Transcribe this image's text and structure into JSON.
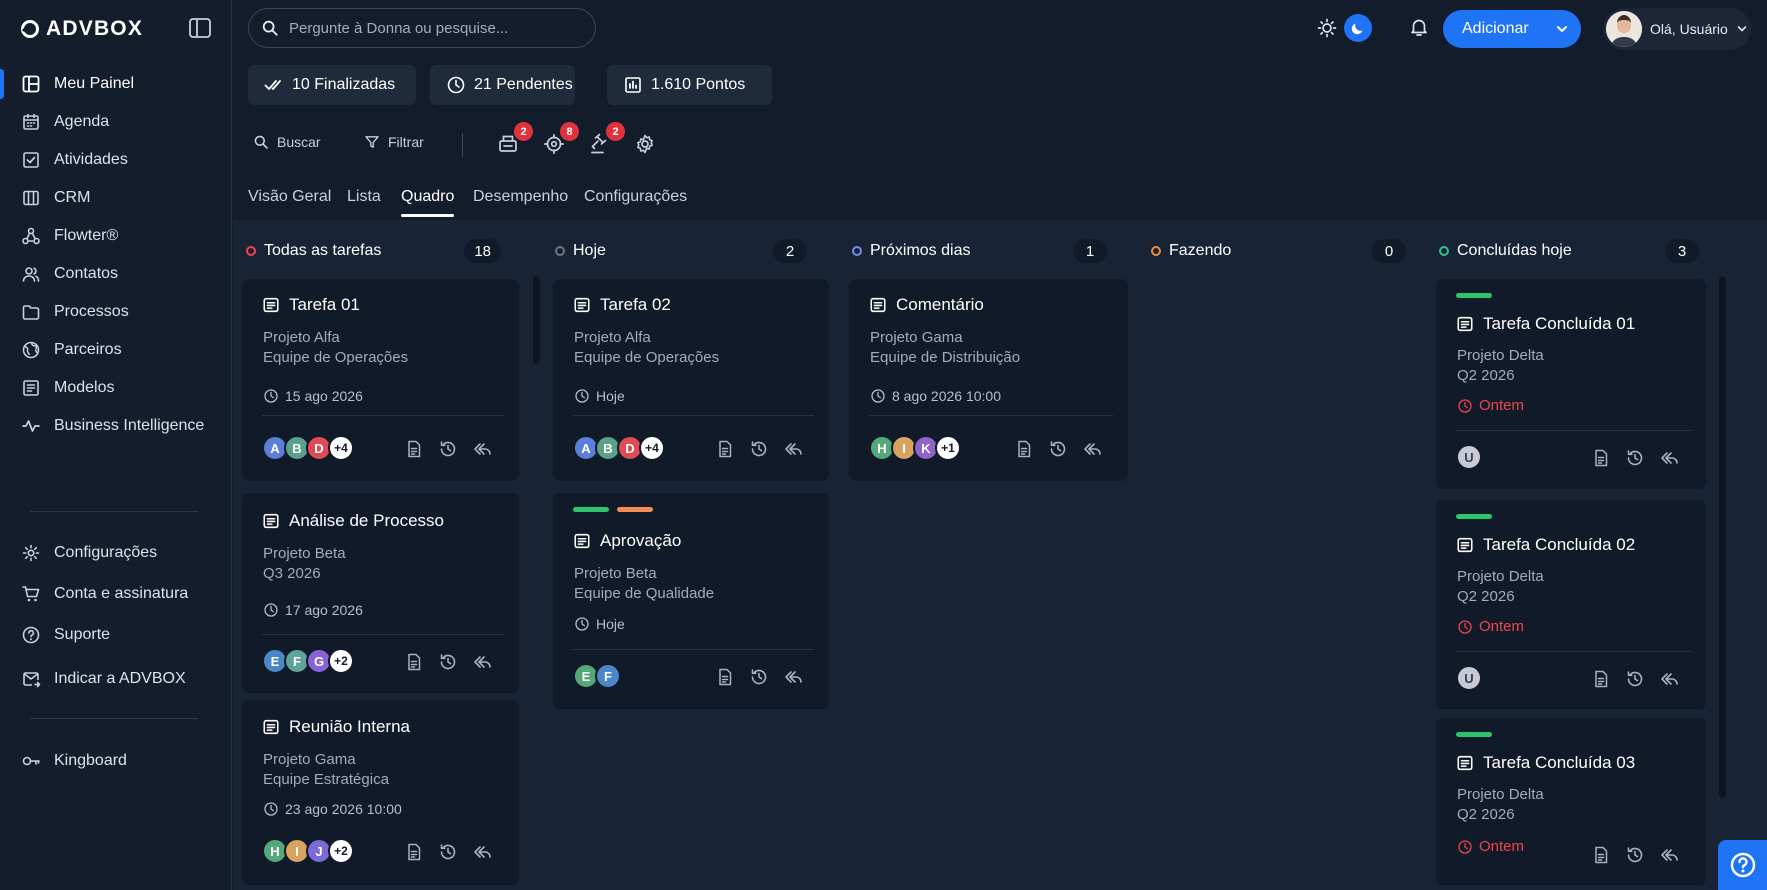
{
  "brand": {
    "name": "ADVBOX"
  },
  "sidebar": {
    "items": [
      {
        "label": "Meu Painel",
        "icon": "dashboard-icon"
      },
      {
        "label": "Agenda",
        "icon": "calendar-icon"
      },
      {
        "label": "Atividades",
        "icon": "checkbox-icon"
      },
      {
        "label": "CRM",
        "icon": "crm-icon"
      },
      {
        "label": "Flowter®",
        "icon": "flow-icon"
      },
      {
        "label": "Contatos",
        "icon": "contacts-icon"
      },
      {
        "label": "Processos",
        "icon": "folder-icon"
      },
      {
        "label": "Parceiros",
        "icon": "globe-icon"
      },
      {
        "label": "Modelos",
        "icon": "templates-icon"
      },
      {
        "label": "Business Intelligence",
        "icon": "pulse-icon"
      }
    ],
    "bottom_items": [
      {
        "label": "Configurações",
        "icon": "gear-icon"
      },
      {
        "label": "Conta e assinatura",
        "icon": "cart-icon"
      },
      {
        "label": "Suporte",
        "icon": "help-icon"
      },
      {
        "label": "Indicar a ADVBOX",
        "icon": "mail-share-icon"
      }
    ],
    "extra_items": [
      {
        "label": "Kingboard",
        "icon": "key-icon"
      }
    ]
  },
  "header": {
    "search_placeholder": "Pergunte à Donna ou pesquise...",
    "add_label": "Adicionar",
    "user_greeting": "Olá, Usuário"
  },
  "stats": {
    "finalizadas": "10 Finalizadas",
    "pendentes": "21 Pendentes",
    "pontos": "1.610 Pontos"
  },
  "toolbar": {
    "buscar": "Buscar",
    "filtrar": "Filtrar",
    "badges": [
      "2",
      "8",
      "2"
    ]
  },
  "tabs": [
    "Visão Geral",
    "Lista",
    "Quadro",
    "Desempenho",
    "Configurações"
  ],
  "active_tab": "Quadro",
  "columns": [
    {
      "title": "Todas as tarefas",
      "count": "18",
      "dot_color": "#f0454f"
    },
    {
      "title": "Hoje",
      "count": "2",
      "dot_color": "#6b7686"
    },
    {
      "title": "Próximos dias",
      "count": "1",
      "dot_color": "#6f8fe6"
    },
    {
      "title": "Fazendo",
      "count": "0",
      "dot_color": "#f28b3c"
    },
    {
      "title": "Concluídas hoje",
      "count": "3",
      "dot_color": "#2ec48b"
    }
  ],
  "cards": {
    "todas": [
      {
        "title": "Tarefa 01",
        "line1": "Projeto Alfa",
        "line2": "Equipe de Operações",
        "date": "15 ago 2026",
        "avatars": [
          "A",
          "B",
          "D"
        ],
        "more": "+4"
      },
      {
        "title": "Análise de Processo",
        "line1": "Projeto Beta",
        "line2": "Q3 2026",
        "date": "17 ago 2026",
        "avatars": [
          "E",
          "F",
          "G"
        ],
        "more": "+2"
      },
      {
        "title": "Reunião Interna",
        "line1": "Projeto Gama",
        "line2": "Equipe Estratégica",
        "date": "23 ago 2026 10:00",
        "avatars": [
          "H",
          "I",
          "J"
        ],
        "more": "+2"
      }
    ],
    "hoje": [
      {
        "title": "Tarefa 02",
        "line1": "Projeto Alfa",
        "line2": "Equipe de Operações",
        "date": "Hoje",
        "avatars": [
          "A",
          "B",
          "D"
        ],
        "more": "+4"
      },
      {
        "title": "Aprovação",
        "line1": "Projeto Beta",
        "line2": "Equipe de Qualidade",
        "date": "Hoje",
        "avatars": [
          "E",
          "F"
        ],
        "more": ""
      }
    ],
    "proximos": [
      {
        "title": "Comentário",
        "line1": "Projeto Gama",
        "line2": "Equipe de Distribuição",
        "date": "8 ago 2026 10:00",
        "avatars": [
          "H",
          "I",
          "K"
        ],
        "more": "+1"
      }
    ],
    "concluidas": [
      {
        "title": "Tarefa Concluída 01",
        "line1": "Projeto Delta",
        "line2": "Q2 2026",
        "date": "Ontem",
        "avatars": [
          "U"
        ]
      },
      {
        "title": "Tarefa Concluída 02",
        "line1": "Projeto Delta",
        "line2": "Q2 2026",
        "date": "Ontem",
        "avatars": [
          "U"
        ]
      },
      {
        "title": "Tarefa Concluída 03",
        "line1": "Projeto Delta",
        "line2": "Q2 2026",
        "date": "Ontem",
        "avatars": []
      }
    ]
  },
  "colors": {
    "accent": "#1f74f5",
    "badge_red": "#e0323c",
    "tag_green": "#2ec46b",
    "tag_orange": "#f28b57",
    "avatar_A": "#5b7fd6",
    "avatar_B": "#5aa08a",
    "avatar_D": "#e04a55",
    "avatar_E": "#4a86c8",
    "avatar_F": "#5fa39a",
    "avatar_G": "#8a62d8",
    "avatar_H": "#55a878",
    "avatar_I": "#d8a35e",
    "avatar_J": "#7b6bd6",
    "avatar_K": "#8f63c9",
    "avatar_U": "#c7c9d3"
  }
}
